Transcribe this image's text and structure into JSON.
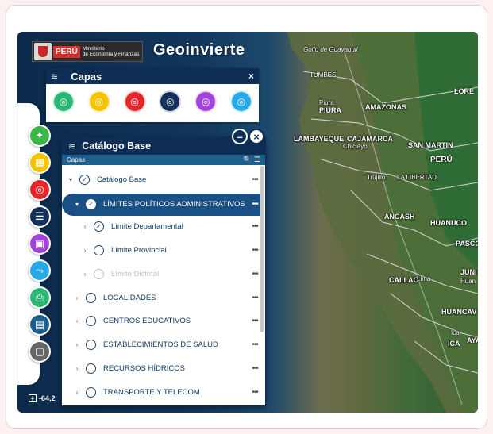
{
  "header": {
    "peru_tag": "PERÚ",
    "ministry_line1": "Ministerio",
    "ministry_line2": "de Economía y Finanzas",
    "app_logo": "Geoinvierte"
  },
  "capas_panel": {
    "title": "Capas",
    "close": "×",
    "layers": [
      {
        "name": "layer-green",
        "color": "#2bb673"
      },
      {
        "name": "layer-yellow",
        "color": "#f5c400"
      },
      {
        "name": "layer-red",
        "color": "#e3262b"
      },
      {
        "name": "layer-navy",
        "color": "#14305a"
      },
      {
        "name": "layer-purple",
        "color": "#a142d9"
      },
      {
        "name": "layer-cyan",
        "color": "#25a9e8"
      }
    ]
  },
  "left_toolbar": [
    {
      "name": "tool-investment",
      "color": "#3cb54a",
      "icon": "chart-icon"
    },
    {
      "name": "tool-projects",
      "color": "#f5c400",
      "icon": "calendar-icon"
    },
    {
      "name": "tool-layers",
      "color": "#e3262b",
      "icon": "layers-icon"
    },
    {
      "name": "tool-list",
      "color": "#14305a",
      "icon": "list-icon"
    },
    {
      "name": "tool-grid",
      "color": "#a142d9",
      "icon": "grid-icon"
    },
    {
      "name": "tool-route",
      "color": "#25a9e8",
      "icon": "route-icon"
    },
    {
      "name": "tool-print",
      "color": "#2bb673",
      "icon": "print-icon"
    },
    {
      "name": "tool-report",
      "color": "#1f5f8b",
      "icon": "report-icon"
    },
    {
      "name": "tool-clipboard",
      "color": "#666666",
      "icon": "clipboard-icon"
    }
  ],
  "catalog": {
    "title": "Catálogo Base",
    "subbar_label": "Capas",
    "subbar_tools": "🔍 ☰",
    "rows": [
      {
        "label": "Catálogo Base",
        "level": 0,
        "checked": true,
        "state": "normal"
      },
      {
        "label": "LÍMITES POLÍTICOS ADMINISTRATIVOS",
        "level": 1,
        "checked": true,
        "state": "selected"
      },
      {
        "label": "Límite Departamental",
        "level": 2,
        "checked": true,
        "state": "normal"
      },
      {
        "label": "Límite Provincial",
        "level": 2,
        "checked": false,
        "state": "normal"
      },
      {
        "label": "Límite Distrital",
        "level": 2,
        "checked": false,
        "state": "disabled"
      },
      {
        "label": "LOCALIDADES",
        "level": 1,
        "checked": false,
        "state": "normal"
      },
      {
        "label": "CENTROS EDUCATIVOS",
        "level": 1,
        "checked": false,
        "state": "normal"
      },
      {
        "label": "ESTABLECIMIENTOS DE SALUD",
        "level": 1,
        "checked": false,
        "state": "normal"
      },
      {
        "label": "RECURSOS HÍDRICOS",
        "level": 1,
        "checked": false,
        "state": "normal"
      },
      {
        "label": "TRANSPORTE Y TELECOM",
        "level": 1,
        "checked": false,
        "state": "normal"
      }
    ]
  },
  "map_labels": {
    "golfo": "Golfo de Guayaquil",
    "tumbes": "TUMBES",
    "piura": "PIURA",
    "piura_city": "Piura",
    "amazonas": "AMAZONAS",
    "lambayeque": "LAMBAYEQUE",
    "cajamarca": "CAJAMARCA",
    "chiclayo": "Chiclayo",
    "sanmartin": "SAN MARTIN",
    "peru": "PERÚ",
    "trujillo": "Trujillo",
    "libertad": "LA LIBERTAD",
    "ancash": "ANCASH",
    "huanuco": "HUANUCO",
    "pasco": "PASCO",
    "lima_region": "CALLAO",
    "lima": "Lima",
    "junin": "JUNÍ",
    "huanc": "Huan",
    "huancavelica": "HUANCAV",
    "ica_city": "Ica",
    "ica": "ICA",
    "aya": "AYA",
    "lore": "LORE"
  },
  "coords": "-64,2"
}
